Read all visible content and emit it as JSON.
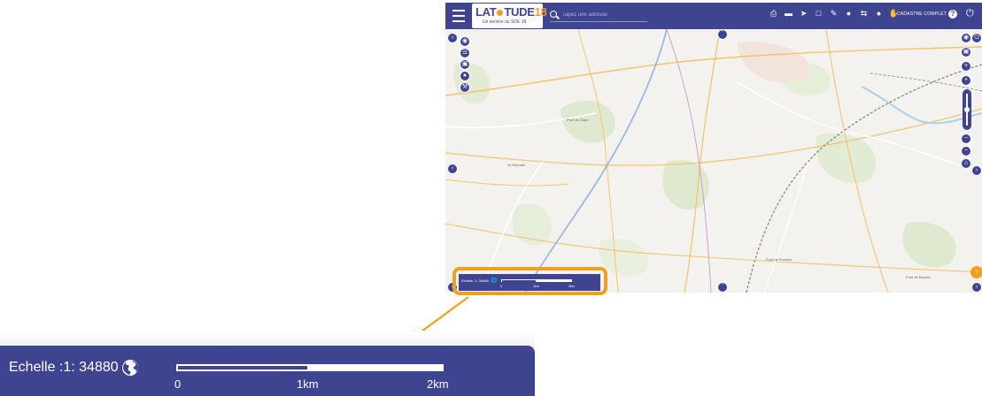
{
  "app": {
    "logo": {
      "text_left": "LAT",
      "text_right": "TUDE",
      "number": "18",
      "subtitle": "Un service du SDE 18"
    },
    "search": {
      "placeholder": "Tapez une adresse"
    },
    "toolbar": {
      "icons": [
        "print-icon",
        "ruler-icon",
        "cursor-icon",
        "layers-icon",
        "pencil-icon",
        "bucket-icon",
        "share-icon",
        "pin-icon",
        "hand-icon"
      ],
      "cadastre_label": "CADASTRE COMPLET",
      "help_label": "?"
    },
    "map": {
      "place_labels": [
        "Pont du Caps",
        "Pont de Bourse",
        "Pont de Rouisse",
        "St Germain"
      ],
      "mini_scale": {
        "text": "Echelle :1: 34880",
        "labels": [
          "0",
          "1km",
          "2km"
        ]
      }
    },
    "colors": {
      "primary": "#3f4490",
      "accent": "#f0a020",
      "map_background": "#f4f2ee"
    }
  },
  "scale": {
    "label": "Echelle :1:",
    "value": "34880",
    "globe_icon": "globe-icon",
    "ticks": [
      "0",
      "1km",
      "2km"
    ]
  }
}
